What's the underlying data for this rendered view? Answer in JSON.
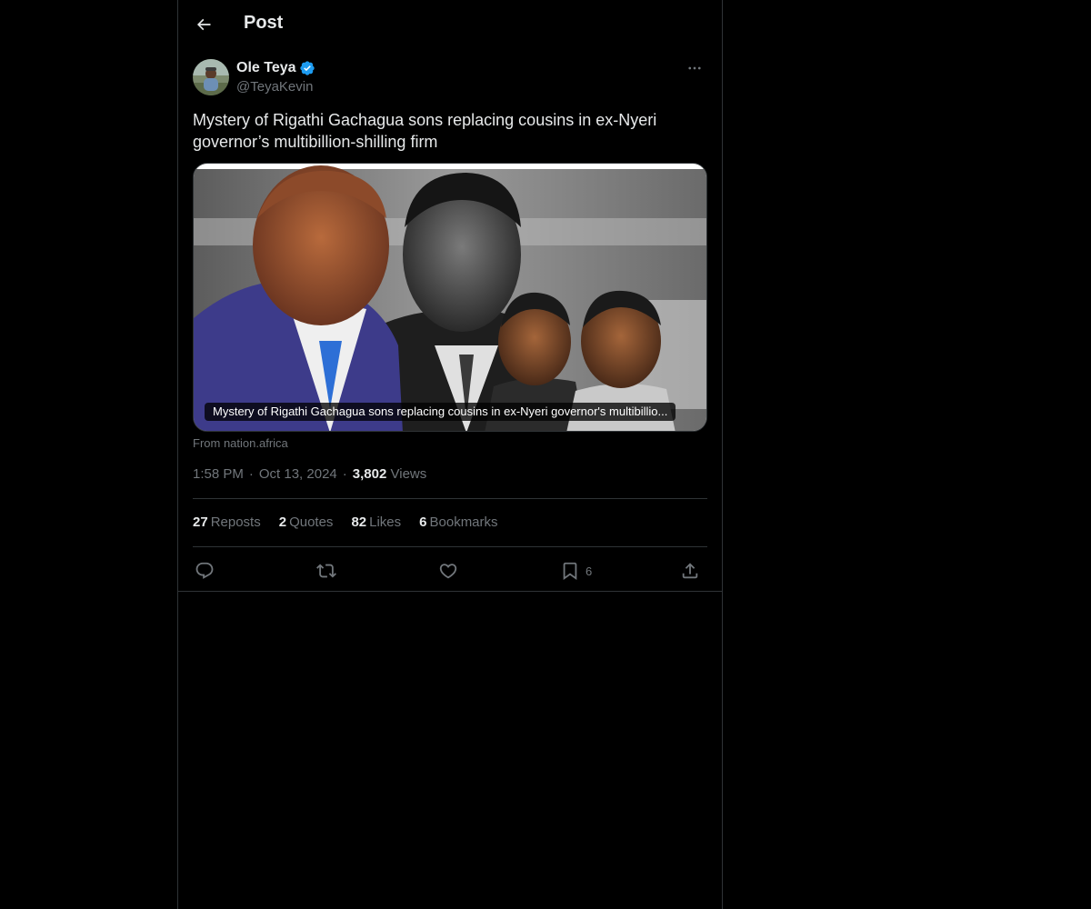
{
  "header": {
    "title": "Post"
  },
  "author": {
    "name": "Ole Teya",
    "handle": "@TeyaKevin",
    "verified": true,
    "verified_color": "#1d9bf0"
  },
  "post": {
    "text": "Mystery of Rigathi Gachagua sons replacing cousins in ex-Nyeri governor’s multibillion-shilling firm"
  },
  "card": {
    "caption": "Mystery of Rigathi Gachagua sons replacing cousins in ex-Nyeri governor's multibillio...",
    "source": "From nation.africa"
  },
  "meta": {
    "time": "1:58 PM",
    "date": "Oct 13, 2024",
    "separator": "·",
    "views_count": "3,802",
    "views_label": "Views"
  },
  "stats": {
    "reposts_count": "27",
    "reposts_label": "Reposts",
    "quotes_count": "2",
    "quotes_label": "Quotes",
    "likes_count": "82",
    "likes_label": "Likes",
    "bookmarks_count": "6",
    "bookmarks_label": "Bookmarks"
  },
  "actions": {
    "bookmark_count": "6"
  },
  "icons": [
    "back-arrow-icon",
    "verified-badge-icon",
    "more-icon",
    "reply-icon",
    "repost-icon",
    "like-icon",
    "bookmark-icon",
    "share-icon"
  ],
  "colors": {
    "background": "#000000",
    "text": "#e7e9ea",
    "muted": "#71767b",
    "border": "#2f3336",
    "accent": "#1d9bf0"
  }
}
